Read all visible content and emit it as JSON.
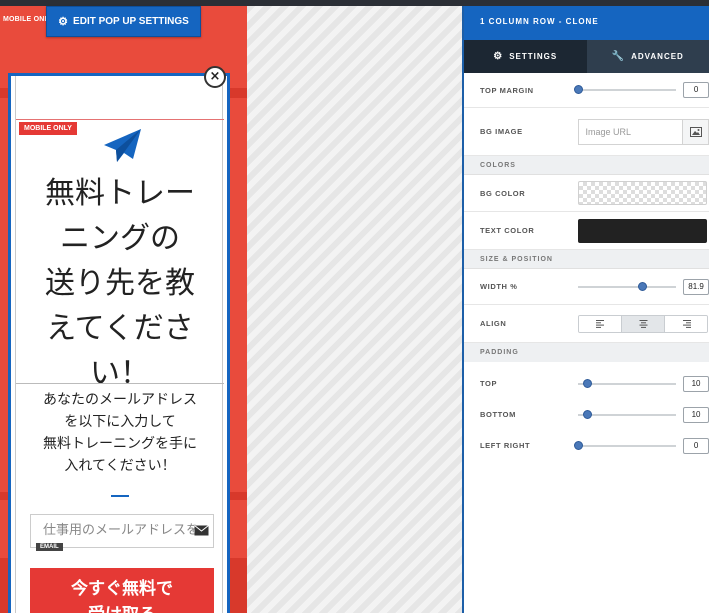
{
  "canvas": {
    "corner_badge": "MOBILE ONLY",
    "edit_button": "EDIT POP UP SETTINGS"
  },
  "popup": {
    "close": "×",
    "mobile_tag": "MOBILE ONLY",
    "heading_lines": [
      "無料トレー",
      "ニングの",
      "送り先を教",
      "えてくださ",
      "い！"
    ],
    "subtext_lines": [
      "あなたのメールアドレス",
      "を以下に入力して",
      "無料トレーニングを手に",
      "入れてください！"
    ],
    "email_placeholder": "仕事用のメールアドレスを",
    "email_tag": "EMAIL",
    "cta_lines": [
      "今すぐ無料で",
      "受け取る"
    ],
    "accent_color": "#1565c0",
    "brand_red": "#e53935"
  },
  "panel": {
    "title": "1 COLUMN ROW - CLONE",
    "tabs": [
      {
        "label": "SETTINGS",
        "icon": "gear-icon",
        "active": true
      },
      {
        "label": "ADVANCED",
        "icon": "wrench-icon",
        "active": false
      }
    ],
    "top_margin": {
      "label": "TOP MARGIN",
      "value": "0",
      "level": 0
    },
    "bg_image": {
      "label": "BG IMAGE",
      "placeholder": "Image URL"
    },
    "colors_section": "COLORS",
    "bg_color": {
      "label": "BG COLOR",
      "value": "transparent"
    },
    "text_color": {
      "label": "TEXT COLOR",
      "value": "#222222"
    },
    "size_section": "SIZE & POSITION",
    "width": {
      "label": "WIDTH %",
      "value": "81.9",
      "level": 0.66
    },
    "align": {
      "label": "ALIGN",
      "options": [
        "left",
        "center",
        "right"
      ],
      "selected": "center"
    },
    "padding_section": "PADDING",
    "padding_top": {
      "label": "TOP",
      "value": "10",
      "level": 0.1
    },
    "padding_bottom": {
      "label": "BOTTOM",
      "value": "10",
      "level": 0.1
    },
    "padding_lr": {
      "label": "LEFT RIGHT",
      "value": "0",
      "level": 0
    }
  }
}
